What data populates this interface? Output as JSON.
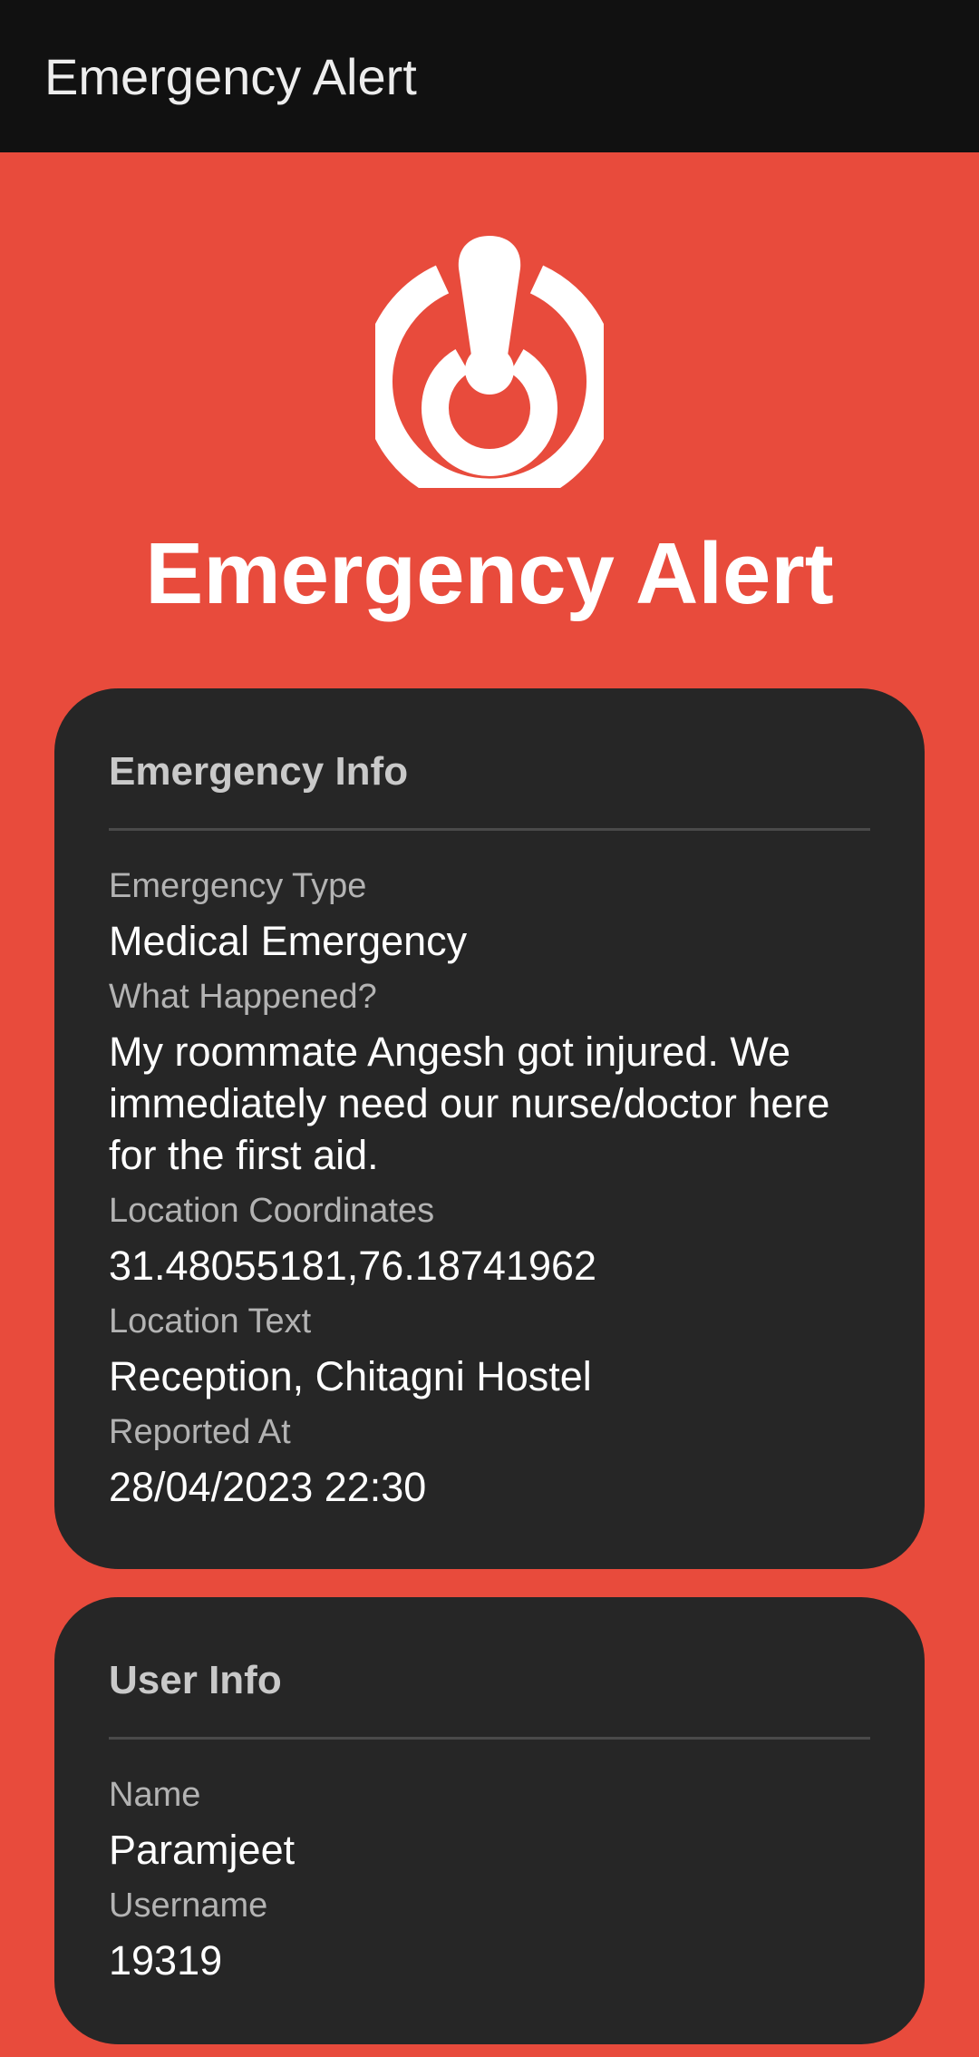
{
  "app_bar": {
    "title": "Emergency Alert"
  },
  "hero": {
    "icon": "alert-power-icon",
    "title": "Emergency Alert"
  },
  "emergency_info": {
    "heading": "Emergency Info",
    "fields": [
      {
        "label": "Emergency Type",
        "value": "Medical Emergency"
      },
      {
        "label": "What Happened?",
        "value": "My roommate Angesh got injured. We immediately need our nurse/doctor here for the first aid."
      },
      {
        "label": "Location Coordinates",
        "value": "31.48055181,76.18741962"
      },
      {
        "label": "Location Text",
        "value": "Reception, Chitagni Hostel"
      },
      {
        "label": "Reported At",
        "value": "28/04/2023 22:30"
      }
    ]
  },
  "user_info": {
    "heading": "User Info",
    "fields": [
      {
        "label": "Name",
        "value": "Paramjeet"
      },
      {
        "label": "Username",
        "value": "19319"
      }
    ]
  },
  "colors": {
    "background": "#e84b3c",
    "app_bar": "#111111",
    "card": "#262626",
    "label": "#b3b3b3",
    "value": "#ffffff"
  }
}
